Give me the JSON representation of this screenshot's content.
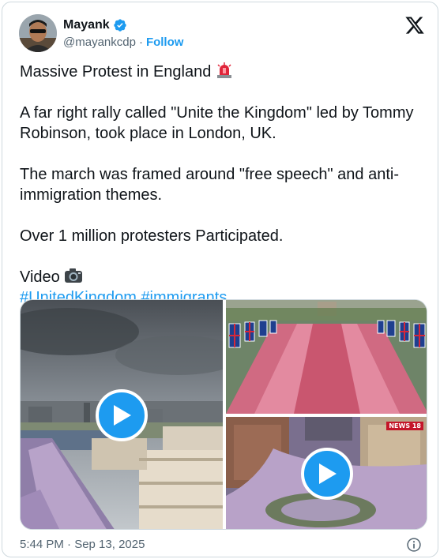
{
  "author": {
    "name": "Mayank",
    "handle": "@mayankcdp",
    "separator": "·",
    "follow_label": "Follow",
    "verified": true
  },
  "tweet": {
    "line1": "Massive Protest in England",
    "line1_emoji": "rotating-light-icon",
    "para2": "A far right rally called \"Unite the Kingdom\" led by Tommy Robinson, took place in London, UK.",
    "para3": "The march was framed around \"free speech\" and anti-immigration themes.",
    "para4": "Over 1 million protesters Participated.",
    "video_label": "Video",
    "video_emoji": "camera-icon",
    "hashtags": [
      "#UnitedKingdom",
      "#immigrants"
    ]
  },
  "media": {
    "tiles": [
      {
        "kind": "video",
        "icon": "play-icon"
      },
      {
        "kind": "image"
      },
      {
        "kind": "video",
        "icon": "play-icon",
        "badge": "NEWS 18"
      }
    ]
  },
  "footer": {
    "timestamp": "5:44 PM · Sep 13, 2025",
    "info_icon": "info-icon"
  },
  "colors": {
    "accent": "#1d9bf0",
    "text": "#0f1419",
    "muted": "#536471",
    "border": "#cfd9de"
  }
}
